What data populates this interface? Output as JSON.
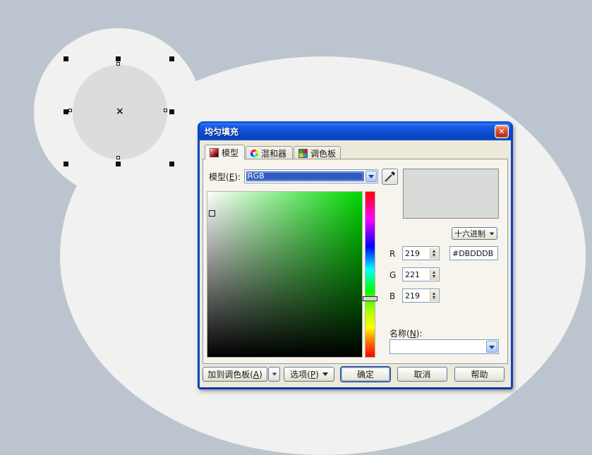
{
  "canvas": {
    "center_marker": "×"
  },
  "dialog": {
    "title": "均匀填充",
    "close_glyph": "✕",
    "tabs": [
      {
        "label": "模型"
      },
      {
        "label": "混和器"
      },
      {
        "label": "调色板"
      }
    ],
    "model_label": {
      "pre": "模型(",
      "key": "E",
      "post": "):"
    },
    "model_value": "RGB",
    "hex_button_label": "十六进制",
    "channels": [
      {
        "label": "R",
        "value": "219"
      },
      {
        "label": "G",
        "value": "221"
      },
      {
        "label": "B",
        "value": "219"
      }
    ],
    "hex_value": "#DBDDDB",
    "name_label": {
      "pre": "名称(",
      "key": "N",
      "post": "):"
    },
    "name_value": "",
    "buttons": {
      "add_to_palette": {
        "pre": "加到调色板(",
        "key": "A",
        "post": ")"
      },
      "options": {
        "pre": "选项(",
        "key": "P",
        "post": ")"
      },
      "ok": "确定",
      "cancel": "取消",
      "help": "帮助"
    }
  }
}
